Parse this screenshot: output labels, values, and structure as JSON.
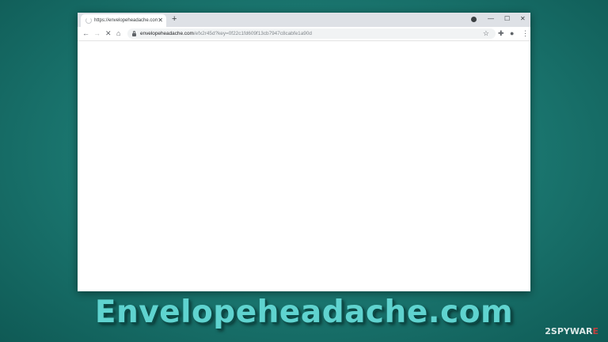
{
  "browser": {
    "tab": {
      "title": "https://envelopeheadache.com/",
      "close_glyph": "✕"
    },
    "new_tab_glyph": "+",
    "window_controls": {
      "minimize": "—",
      "maximize": "☐",
      "close": "✕"
    },
    "toolbar": {
      "back": "←",
      "forward": "→",
      "stop": "✕",
      "home": "⌂",
      "url_host": "envelopeheadache.com",
      "url_path": "/efx2r45d?key=0f22c1fd609f13cb7947c8cabfe1a90d",
      "star": "☆",
      "extensions": "✚",
      "account": "●",
      "menu": "⋮"
    }
  },
  "headline": "Envelopeheadache.com",
  "watermark": {
    "part1": "2SPYWAR",
    "part2": "E"
  },
  "colors": {
    "background": "#1c7a73",
    "headline": "#5fd3cf",
    "tabbar": "#dee1e6"
  }
}
